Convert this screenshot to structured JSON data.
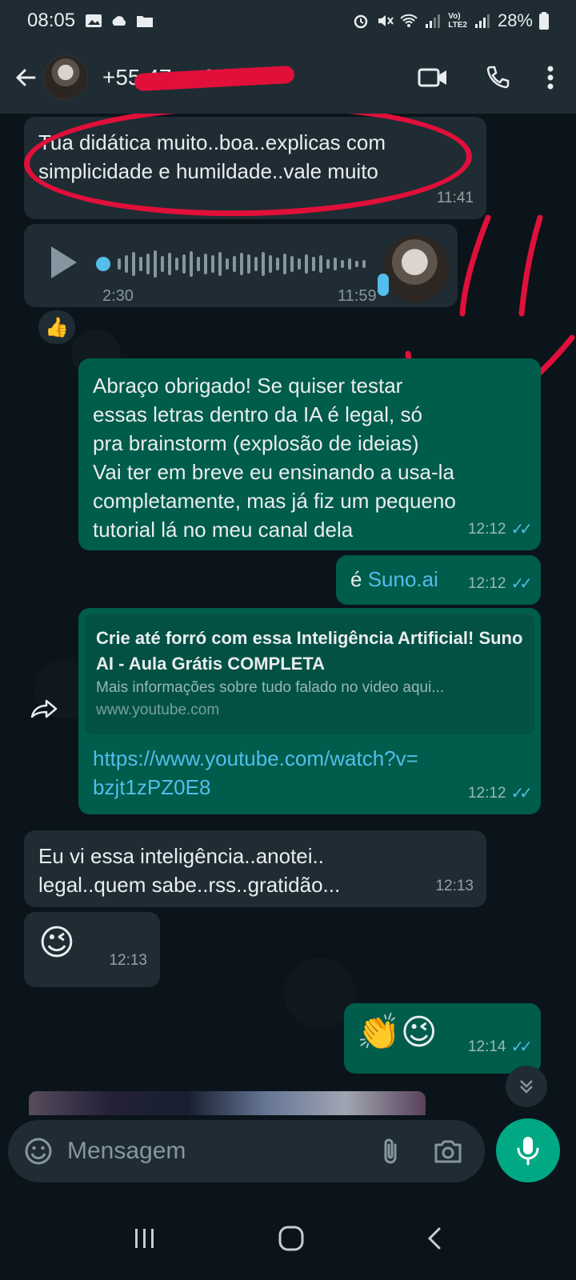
{
  "status_bar": {
    "time": "08:05",
    "signal_label_1": "Vo)",
    "signal_label_2": "LTE2",
    "battery": "28%"
  },
  "header": {
    "contact": "+55 47 ... 6114"
  },
  "messages": [
    {
      "type": "text",
      "direction": "in",
      "text_lines": [
        "Tua didática muito..boa..explicas com",
        "simplicidade e humildade..vale muito"
      ],
      "time": "11:41"
    },
    {
      "type": "voice",
      "direction": "in",
      "duration": "2:30",
      "time": "11:59",
      "reaction": "👍"
    },
    {
      "type": "text",
      "direction": "out",
      "text_lines": [
        "Abraço obrigado! Se quiser testar",
        "essas letras dentro da IA é legal, só",
        "pra brainstorm (explosão de ideias)",
        "Vai ter em breve eu ensinando a usa-la",
        "completamente, mas já fiz um pequeno",
        "tutorial lá no meu canal dela"
      ],
      "time": "12:12"
    },
    {
      "type": "text",
      "direction": "out",
      "prefix": "é",
      "link": "Suno.ai",
      "time": "12:12"
    },
    {
      "type": "link",
      "direction": "out",
      "preview_title": "Crie até forró com essa Inteligência Artificial! Suno AI - Aula Grátis COMPLETA",
      "preview_desc": "Mais informações sobre tudo falado no video aqui...",
      "preview_domain": "www.youtube.com",
      "url_lines": [
        "https://www.youtube.com/watch?v=",
        "bzjt1zPZ0E8"
      ],
      "time": "12:12"
    },
    {
      "type": "text",
      "direction": "in",
      "text_lines": [
        "Eu vi essa inteligência..anotei..",
        "legal..quem sabe..rss..gratidão..."
      ],
      "time": "12:13"
    },
    {
      "type": "emoji",
      "direction": "in",
      "text": "😉",
      "time": "12:13"
    },
    {
      "type": "emoji",
      "direction": "out",
      "text": "👏😉",
      "time": "12:14"
    }
  ],
  "input": {
    "placeholder": "Mensagem"
  },
  "icons": {
    "back": "arrow-left-icon",
    "video": "video-call-icon",
    "call": "phone-icon",
    "menu": "more-vert-icon",
    "emoji": "emoji-icon",
    "attach": "paperclip-icon",
    "camera": "camera-icon",
    "mic": "mic-icon",
    "forward": "forward-icon",
    "scroll": "chevrons-down-icon"
  },
  "colors": {
    "background": "#0b141a",
    "bar": "#1f2c34",
    "incoming": "#1f2c34",
    "outgoing": "#005c4b",
    "accent": "#00a884",
    "link": "#53bdeb",
    "annotation": "#e0103a"
  }
}
